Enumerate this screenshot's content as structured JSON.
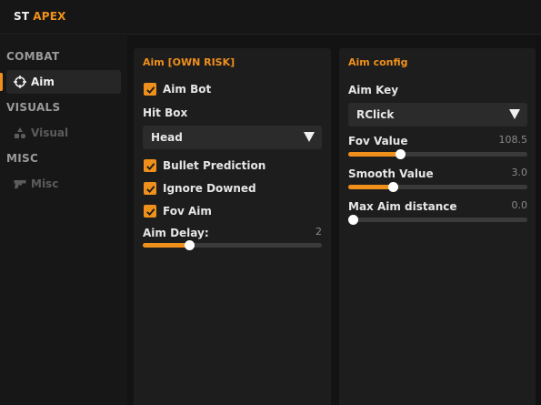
{
  "app": {
    "title_part1": "ST",
    "title_part2": "APEX",
    "accent": "#f0901c"
  },
  "sidebar": {
    "sections": [
      {
        "label": "COMBAT",
        "items": [
          {
            "label": "Aim",
            "icon": "crosshair-icon",
            "active": true
          }
        ]
      },
      {
        "label": "VISUALS",
        "items": [
          {
            "label": "Visual",
            "icon": "shapes-icon",
            "active": false
          }
        ]
      },
      {
        "label": "MISC",
        "items": [
          {
            "label": "Misc",
            "icon": "gun-icon",
            "active": false
          }
        ]
      }
    ]
  },
  "aim_panel": {
    "title": "Aim [OWN RISK]",
    "aim_bot": {
      "label": "Aim Bot",
      "checked": true
    },
    "hit_box": {
      "label": "Hit Box",
      "value": "Head"
    },
    "bullet_prediction": {
      "label": "Bullet Prediction",
      "checked": true
    },
    "ignore_downed": {
      "label": "Ignore Downed",
      "checked": true
    },
    "fov_aim": {
      "label": "Fov Aim",
      "checked": true
    },
    "aim_delay": {
      "label": "Aim Delay:",
      "value": "2",
      "fraction": 0.26
    }
  },
  "config_panel": {
    "title": "Aim config",
    "aim_key": {
      "label": "Aim Key",
      "value": "RClick"
    },
    "fov_value": {
      "label": "Fov Value",
      "value": "108.5",
      "fraction": 0.29
    },
    "smooth_value": {
      "label": "Smooth Value",
      "value": "3.0",
      "fraction": 0.25
    },
    "max_aim_distance": {
      "label": "Max Aim distance",
      "value": "0.0",
      "fraction": 0.0
    }
  }
}
